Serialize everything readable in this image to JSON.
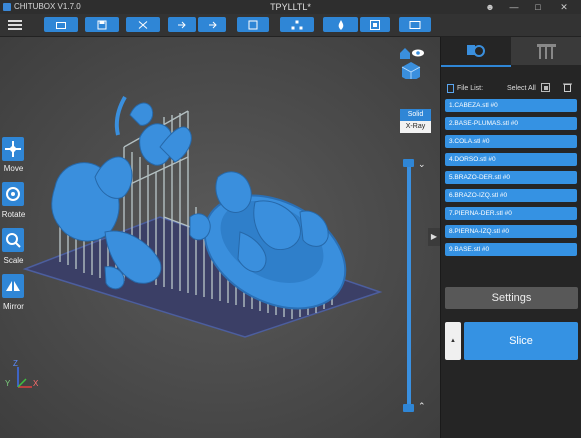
{
  "app": {
    "name": "CHITUBOX V1.7.0",
    "window_title": "TPYLLTL*"
  },
  "window_controls": {
    "user": "user-icon",
    "minimize": "minimize-icon",
    "maximize": "maximize-icon",
    "close": "close-icon"
  },
  "toolbar": {
    "buttons": [
      "open-folder-icon",
      "save-icon",
      "add-model-icon",
      "import-icon",
      "export-icon",
      "save-file-icon",
      "network-icon",
      "drop-icon",
      "printer-settings-icon",
      "screenshot-icon"
    ]
  },
  "tools": {
    "move": "Move",
    "rotate": "Rotate",
    "scale": "Scale",
    "mirror": "Mirror"
  },
  "view": {
    "solid": "Solid",
    "xray": "X-Ray"
  },
  "panel": {
    "tab_settings_icon": "gear-icon",
    "tab_supports_icon": "supports-icon",
    "file_list_label": "File List:",
    "select_all_label": "Select All",
    "files": [
      "1.CABEZA.stl #0",
      "2.BASE-PLUMAS.stl #0",
      "3.COLA.stl #0",
      "4.DORSO.stl #0",
      "5.BRAZO-DER.stl #0",
      "6.BRAZO-IZQ.stl #0",
      "7.PIERNA-DER.stl #0",
      "8.PIERNA-IZQ.stl #0",
      "9.BASE.stl #0"
    ],
    "settings_label": "Settings",
    "slice_label": "Slice"
  },
  "axes": {
    "x": "X",
    "y": "Y",
    "z": "Z"
  },
  "colors": {
    "accent": "#2f86d6",
    "model": "#3a8fdd",
    "support": "#b9c6c8",
    "plate": "#3b3f66"
  }
}
